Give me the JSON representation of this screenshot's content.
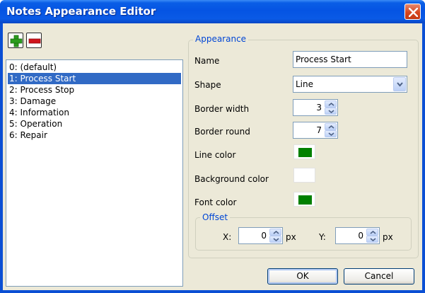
{
  "window": {
    "title": "Notes Appearance Editor"
  },
  "toolbar": {
    "add_tooltip": "",
    "remove_tooltip": ""
  },
  "list": {
    "items": [
      "0: (default)",
      "1: Process Start",
      "2: Process Stop",
      "3: Damage",
      "4: Information",
      "5: Operation",
      "6: Repair"
    ],
    "selected_index": 1
  },
  "appearance": {
    "group_title": "Appearance",
    "name_label": "Name",
    "name_value": "Process Start",
    "shape_label": "Shape",
    "shape_value": "Line",
    "border_width_label": "Border width",
    "border_width_value": "3",
    "border_round_label": "Border round",
    "border_round_value": "7",
    "line_color_label": "Line color",
    "line_color": "#008000",
    "background_color_label": "Background color",
    "background_color": "#ffffff",
    "font_color_label": "Font color",
    "font_color": "#008000"
  },
  "offset": {
    "group_title": "Offset",
    "x_label": "X:",
    "x_value": "0",
    "y_label": "Y:",
    "y_value": "0",
    "unit": "px"
  },
  "buttons": {
    "ok_label": "OK",
    "cancel_label": "Cancel"
  }
}
